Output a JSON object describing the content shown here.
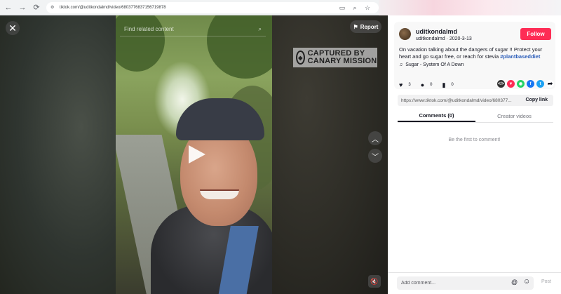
{
  "browser": {
    "url": "tiktok.com/@uditkondalmd/video/6803776837156719878",
    "back_icon": "arrow-left-icon",
    "forward_icon": "arrow-right-icon",
    "reload_icon": "reload-icon"
  },
  "player": {
    "search_placeholder": "Find related content",
    "report_label": "Report",
    "watermark_text": "CAPTURED BY CANARY MISSION"
  },
  "post": {
    "username": "uditkondalmd",
    "handle": "uditkondalmd",
    "date": "2020-3-13",
    "follow_label": "Follow",
    "description": "On vacation talking about the dangers of sugar !! Protect your heart and go sugar free, or reach for stevia ",
    "hashtag": "#plantbaseddiet",
    "music": "Sugar - System Of A Down",
    "likes": "3",
    "comments": "0",
    "saves": "0",
    "link": "https://www.tiktok.com/@uditkondalmd/video/680377...",
    "copy_link_label": "Copy link"
  },
  "tabs": [
    {
      "label": "Comments (0)"
    },
    {
      "label": "Creator videos"
    }
  ],
  "comments": {
    "empty_text": "Be the first to comment!",
    "input_placeholder": "Add comment...",
    "post_label": "Post"
  },
  "colors": {
    "follow": "#fe2c55",
    "hashtag": "#2b5db9"
  }
}
